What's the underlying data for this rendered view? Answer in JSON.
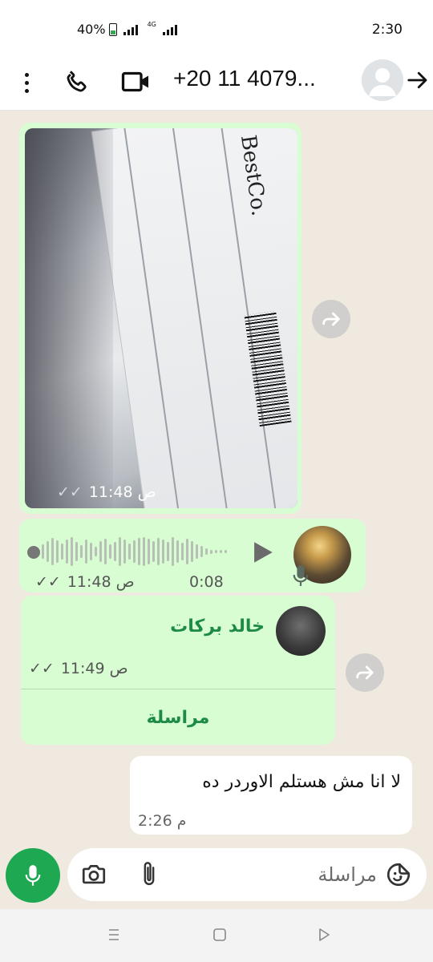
{
  "status_bar": {
    "battery": "40%",
    "network": "4G",
    "time": "2:30"
  },
  "header": {
    "contact_title": "+20 11 4079...",
    "icons": [
      "menu-dots-icon",
      "phone-call-icon",
      "video-call-icon",
      "default-avatar-icon",
      "back-arrow-icon"
    ]
  },
  "messages": {
    "image": {
      "photo_logo": "BestCo.",
      "time": "11:48 ص"
    },
    "voice": {
      "duration": "0:08",
      "time": "11:48 ص"
    },
    "contact": {
      "name": "خالد بركات",
      "time": "11:49 ص",
      "action": "مراسلة"
    },
    "text": {
      "body": "لا انا مش هستلم الاوردر ده",
      "time": "2:26 م"
    }
  },
  "composer": {
    "placeholder": "مراسلة"
  },
  "colors": {
    "outgoing_bubble": "#d8fdd2",
    "incoming_bubble": "#ffffff",
    "accent_green": "#1da851",
    "contact_green": "#1e8a48",
    "chat_background": "#efe9df"
  }
}
